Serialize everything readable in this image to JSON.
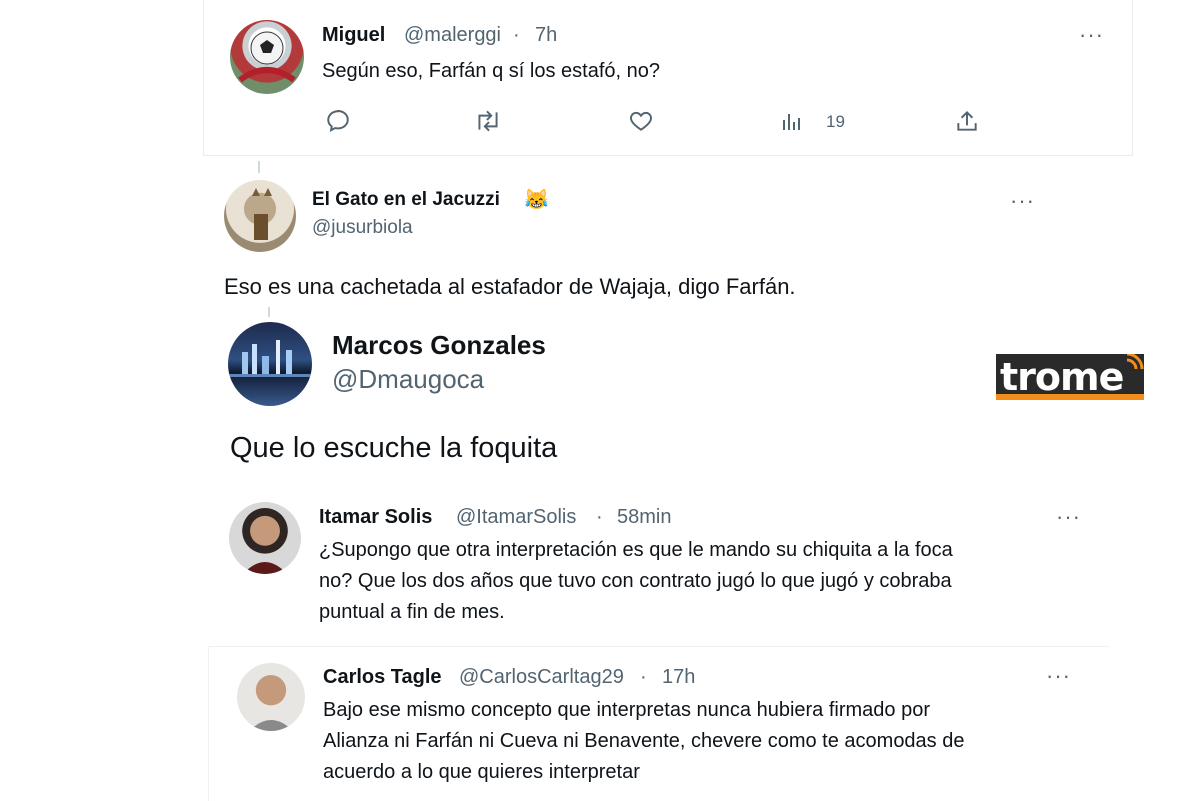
{
  "tweets": [
    {
      "name": "Miguel",
      "handle": "@malerggi",
      "time": "7h",
      "text": "Según eso, Farfán q sí los estafó, no?",
      "actions": {
        "views": "19"
      }
    },
    {
      "name": "El Gato en el Jacuzzi",
      "emoji": "😹",
      "handle": "@jusurbiola",
      "text": "Eso es una cachetada al estafador de Wajaja, digo Farfán."
    },
    {
      "name": "Marcos Gonzales",
      "handle": "@Dmaugoca",
      "text": "Que lo escuche la foquita"
    },
    {
      "name": "Itamar Solis",
      "handle": "@ItamarSolis",
      "time": "58min",
      "lines": [
        "¿Supongo que otra interpretación es que le mando su chiquita a la foca",
        "no? Que los dos años que tuvo con contrato jugó lo que jugó y cobraba",
        "puntual a fin de mes."
      ]
    },
    {
      "name": "Carlos Tagle",
      "handle": "@CarlosCarltag29",
      "time": "17h",
      "lines": [
        "Bajo ese mismo concepto que interpretas nunca hubiera firmado por",
        "Alianza ni Farfán ni Cueva ni Benavente, chevere como te acomodas de",
        "acuerdo a lo que quieres interpretar"
      ]
    }
  ],
  "more_label": "···",
  "separator": " · ",
  "brand": {
    "logo": "trome",
    "color": "#f28c1a"
  }
}
